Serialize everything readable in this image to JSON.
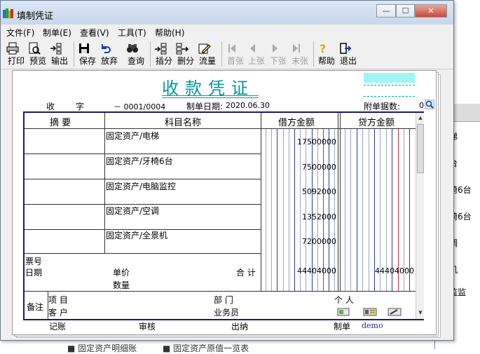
{
  "window": {
    "title": "填制凭证"
  },
  "menu": [
    "文件(F)",
    "制单(E)",
    "查看(V)",
    "工具(T)",
    "帮助(H)"
  ],
  "toolbar": {
    "print": "打印",
    "preview": "预览",
    "export": "输出",
    "save": "保存",
    "discard": "放弃",
    "query": "查询",
    "insert_line": "插分",
    "delete_line": "删分",
    "cashflow": "流量",
    "first": "首张",
    "prev": "上张",
    "next": "下张",
    "last": "末张",
    "help": "帮助",
    "exit": "退出"
  },
  "voucher": {
    "title": "收款凭证",
    "type_label": "收",
    "no_label": "字",
    "number": "－ 0001/0004",
    "date_label": "制单日期:",
    "date": "2020.06.30",
    "attach_label": "附单据数:",
    "attach_count": "0",
    "headers": {
      "summary": "摘 要",
      "account": "科目名称",
      "debit": "借方金额",
      "credit": "贷方金额"
    },
    "rows": [
      {
        "account": "固定资产/电梯",
        "debit": "17500000"
      },
      {
        "account": "固定资产/牙椅6台",
        "debit": "7500000"
      },
      {
        "account": "固定资产/电脑监控",
        "debit": "5092000"
      },
      {
        "account": "固定资产/空调",
        "debit": "1352000"
      },
      {
        "account": "固定资产/全景机",
        "debit": "7200000"
      }
    ],
    "ticket_no_label": "票号",
    "ticket_date_label": "日期",
    "price_label": "单价",
    "qty_label": "数量",
    "total_label": "合 计",
    "total_debit": "44404000",
    "total_credit": "44404000",
    "remarks": {
      "label": "备注",
      "project_label": "项 目",
      "customer_label": "客 户",
      "dept_label": "部 门",
      "salesman_label": "业务员",
      "person_label": "个 人"
    },
    "footer": {
      "bookkeeping": "记账",
      "audit": "审核",
      "cashier": "出纳",
      "maker_label": "制单",
      "maker": "demo"
    }
  },
  "background": {
    "rows": [
      "梯",
      "台",
      "椅6台",
      "椅6台",
      "调",
      "机",
      "监监"
    ],
    "bottom_left": "■ 固定资产明细账",
    "bottom_right": "■ 固定资产原值一览表"
  }
}
